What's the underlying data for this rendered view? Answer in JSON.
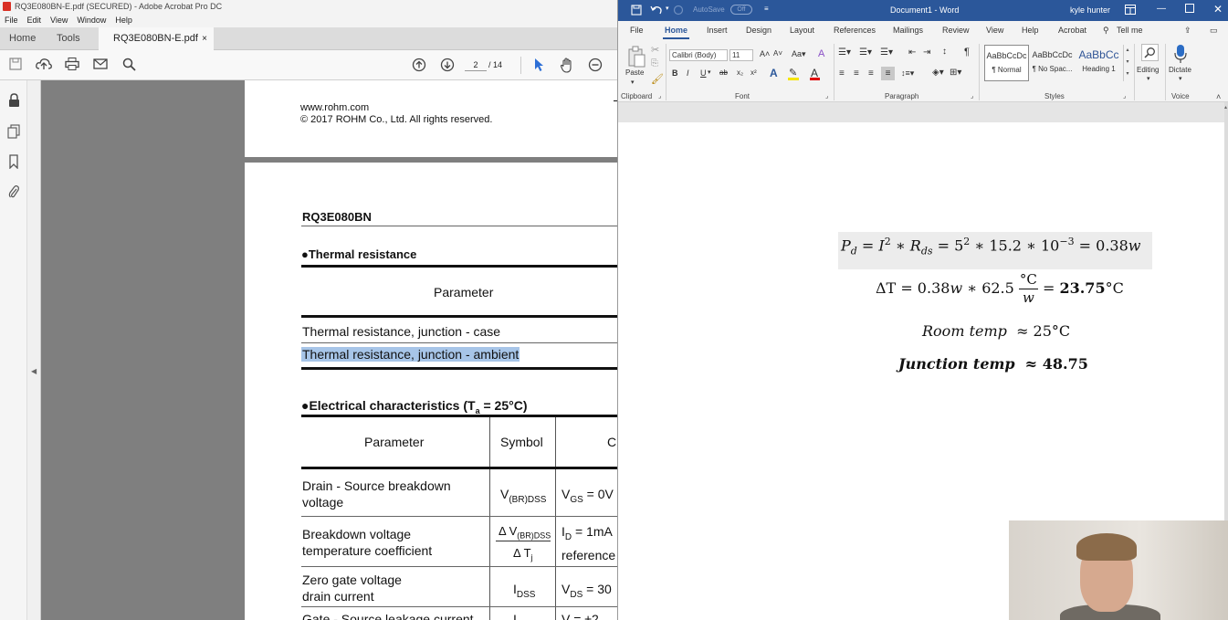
{
  "acrobat": {
    "window_title": "RQ3E080BN-E.pdf (SECURED) - Adobe Acrobat Pro DC",
    "menu": [
      "File",
      "Edit",
      "View",
      "Window",
      "Help"
    ],
    "tabs": {
      "home": "Home",
      "tools": "Tools",
      "doc": "RQ3E080BN-E.pdf (...",
      "close": "×"
    },
    "page_current": "2",
    "page_total": "/ 14",
    "page1": {
      "url": "www.rohm.com",
      "copyright": "© 2017 ROHM Co., Ltd. All rights reserved."
    },
    "page2": {
      "part": "RQ3E080BN",
      "thermal_heading": "●Thermal resistance",
      "thermal_param_header": "Parameter",
      "thermal_rows": [
        "Thermal resistance, junction - case",
        "Thermal resistance, junction - ambient"
      ],
      "elec_heading_prefix": "●Electrical characteristics (T",
      "elec_heading_sub": "a",
      "elec_heading_suffix": " = 25°C)",
      "elec_headers": {
        "param": "Parameter",
        "symbol": "Symbol",
        "cond": "C"
      },
      "elec_rows": [
        {
          "param1": "Drain - Source breakdown",
          "param2": "voltage",
          "sym": "V",
          "sym_sub": "(BR)DSS",
          "cond": "V",
          "cond_sub": "GS",
          "cond_rest": " = 0V"
        },
        {
          "param1": "Breakdown voltage",
          "param2": "temperature coefficient",
          "sym": "Δ V",
          "sym_sub": "(BR)DSS",
          "sym2": "Δ T",
          "sym2_sub": "j",
          "cond": "I",
          "cond_sub": "D",
          "cond_rest": " = 1mA",
          "cond2": "reference"
        },
        {
          "param1": "Zero gate voltage",
          "param2": "drain current",
          "sym": "I",
          "sym_sub": "DSS",
          "cond": "V",
          "cond_sub": "DS",
          "cond_rest": " = 30"
        },
        {
          "param1": "Gate - Source leakage current",
          "param2": "",
          "sym": "I",
          "sym_sub": "",
          "cond": "V",
          "cond_sub": "",
          "cond_rest": " = ±2"
        }
      ]
    }
  },
  "word": {
    "autosave": "AutoSave",
    "autosave_state": "Off",
    "title": "Document1 - Word",
    "user": "kyle hunter",
    "tabs": [
      "File",
      "Home",
      "Insert",
      "Design",
      "Layout",
      "References",
      "Mailings",
      "Review",
      "View",
      "Help",
      "Acrobat"
    ],
    "tell_me": "Tell me",
    "font_name": "Calibri (Body)",
    "font_size": "11",
    "groups": {
      "clipboard": "Clipboard",
      "font": "Font",
      "paragraph": "Paragraph",
      "styles": "Styles",
      "voice": "Voice"
    },
    "paste": "Paste",
    "styles": [
      {
        "preview": "AaBbCcDc",
        "name": "¶ Normal"
      },
      {
        "preview": "AaBbCcDc",
        "name": "¶ No Spac..."
      },
      {
        "preview": "AaBbCc",
        "name": "Heading 1"
      }
    ],
    "editing": "Editing",
    "dictate": "Dictate",
    "equations": {
      "eq1": {
        "Pd": "P",
        "Pd_sub": "d",
        "I": "I",
        "I_exp": "2",
        "R": "R",
        "R_sub": "ds",
        "five": "5",
        "five_exp": "2",
        "rest": " ∗ 15.2 ∗ 10",
        "ten_exp": "−3",
        "result": " = 0.38",
        "w": "w"
      },
      "eq2": {
        "lhs": "ΔT = 0.38",
        "w": "w",
        "mid": " ∗ 62.5",
        "frac_num": "°C",
        "frac_den": "w",
        "eq": " = ",
        "bold": "23.75",
        "unit": "°C"
      },
      "eq3": {
        "label": "Room temp",
        "approx": "≈ 25°C"
      },
      "eq4": {
        "label": "Junction temp",
        "approx": "≈ 48.75"
      }
    }
  }
}
